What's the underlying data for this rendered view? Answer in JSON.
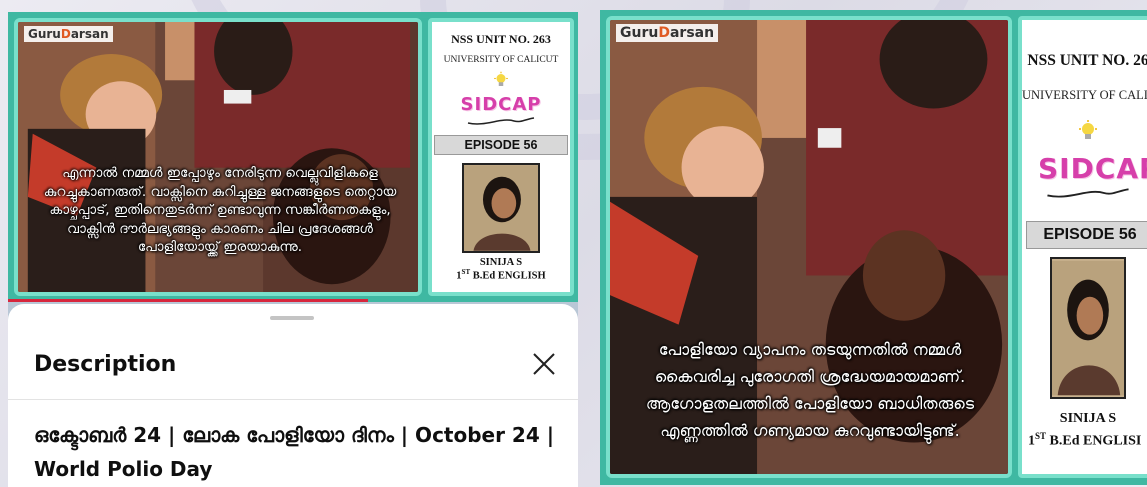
{
  "left_panel": {
    "logo": {
      "prefix": "Guru",
      "mid": "D",
      "suffix": "arsan"
    },
    "overlay_text": "എന്നാൽ നമ്മൾ ഇപ്പോഴും നേരിടുന്ന വെല്ലുവിളികളെ കുറച്ചുകാണരുത്. വാക്സിനെ കുറിച്ചുള്ള ജനങ്ങളുടെ തെറ്റായ കാഴ്ചപ്പാട്, ഇതിനെതുടർന്ന് ഉണ്ടാവുന്ന സങ്കീർണതകളും, വാക്സിൻ ദൗർലഭ്യങ്ങളും കാരണം ചില പ്രദേശങ്ങൾ പോളിയോയ്ക്ക് ഇരയാകുന്നു.",
    "sidebar": {
      "unit": "NSS UNIT NO. 263",
      "university": "UNIVERSITY OF CALICUT",
      "brand": "SIDCAP",
      "episode": "EPISODE 56",
      "name": "SINIJA S",
      "course_num": "1",
      "course_sup": "ST",
      "course_rest": " B.Ed ENGLISH"
    },
    "description": {
      "title": "Description",
      "text": "ഒക്ടോബർ 24 | ലോക പോളിയോ ദിനം | October 24 | World Polio Day"
    }
  },
  "right_panel": {
    "logo": {
      "prefix": "Guru",
      "mid": "D",
      "suffix": "arsan"
    },
    "overlay_text": "പോളിയോ വ്യാപനം തടയുന്നതിൽ നമ്മൾ കൈവരിച്ച പുരോഗതി ശ്രദ്ധേയമായമാണ്. ആഗോളതലത്തിൽ പോളിയോ ബാധിതരുടെ എണ്ണത്തിൽ ഗണ്യമായ കുറവുണ്ടായിട്ടുണ്ട്.",
    "sidebar": {
      "unit": "NSS UNIT NO. 26",
      "university": "UNIVERSITY OF CALIC",
      "brand": "SIDCAP",
      "episode": "EPISODE 56",
      "name": "SINIJA S",
      "course_num": "1",
      "course_sup": "ST",
      "course_rest": " B.Ed ENGLISI"
    }
  },
  "colors": {
    "teal_border": "#79e0cb",
    "teal_bg": "#3fb8a2",
    "brand_pink": "#d63faa",
    "accent_red": "#d7263d"
  }
}
